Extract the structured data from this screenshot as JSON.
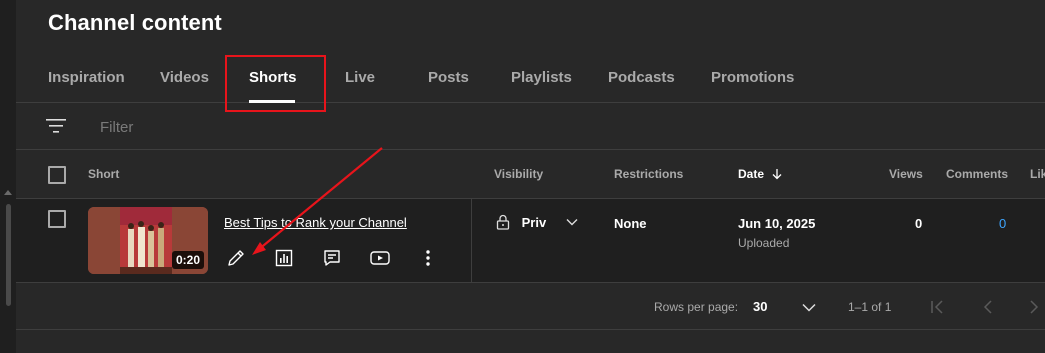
{
  "page": {
    "title": "Channel content"
  },
  "tabs": [
    {
      "label": "Inspiration",
      "active": false
    },
    {
      "label": "Videos",
      "active": false
    },
    {
      "label": "Shorts",
      "active": true
    },
    {
      "label": "Live",
      "active": false
    },
    {
      "label": "Posts",
      "active": false
    },
    {
      "label": "Playlists",
      "active": false
    },
    {
      "label": "Podcasts",
      "active": false
    },
    {
      "label": "Promotions",
      "active": false
    }
  ],
  "filter": {
    "placeholder": "Filter",
    "icon": "filter-lines-icon"
  },
  "table": {
    "columns": [
      "Short",
      "Visibility",
      "Restrictions",
      "Date",
      "Views",
      "Comments",
      "Lik"
    ],
    "sort_icon": "arrow-down-icon",
    "rows": [
      {
        "title": "Best Tips to Rank your Channel",
        "duration": "0:20",
        "visibility": "Priv",
        "restrictions": "None",
        "date": "Jun 10, 2025",
        "date_status": "Uploaded",
        "views": "0",
        "comments": "0",
        "actions": [
          "pencil-icon",
          "analytics-icon",
          "comments-icon",
          "youtube-icon",
          "more-vert-icon"
        ]
      }
    ]
  },
  "pagination": {
    "rows_per_page_label": "Rows per page:",
    "rows_per_page_value": "30",
    "range": "1–1 of 1"
  },
  "colors": {
    "background": "#282828",
    "row_background": "#1f1f1f",
    "highlight": "#e8141b",
    "link": "#3ea6ff"
  }
}
